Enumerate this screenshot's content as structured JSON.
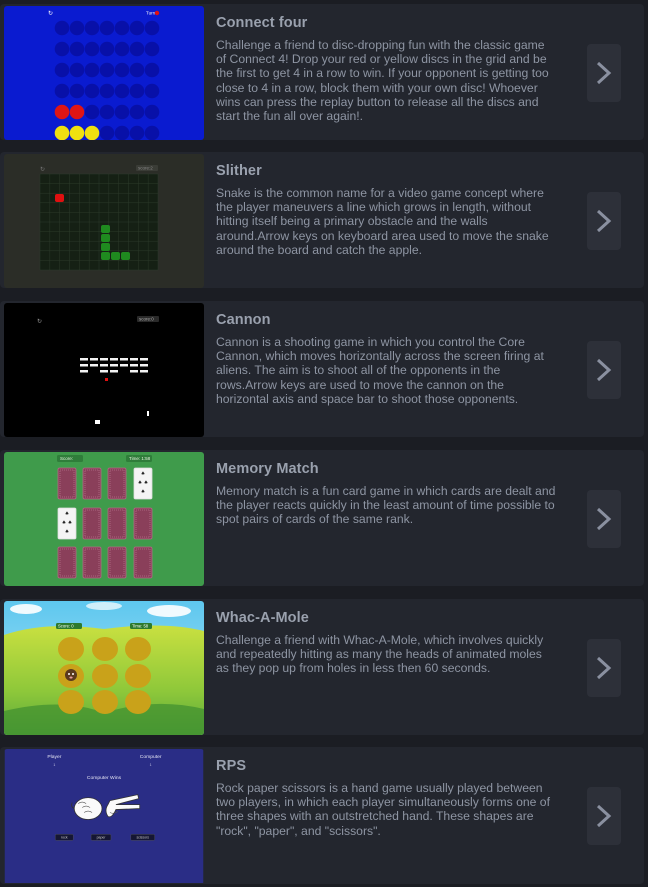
{
  "games": [
    {
      "title": "Connect four",
      "description": "Challenge a friend to disc-dropping fun with the classic game of Connect 4! Drop your red or yellow discs in the grid and be the first to get 4 in a row to win. If your opponent is getting too close to 4 in a row, block them with your own disc! Whoever wins can press the replay button to release all the discs and start the fun all over again!.",
      "thumb": {
        "turn_label": "Turn",
        "replay_icon": "replay-icon"
      }
    },
    {
      "title": "Slither",
      "description": "Snake is the common name for a video game concept where the player maneuvers a line which grows in length, without hitting itself being a primary obstacle and the walls around.Arrow keys on keyboard area used to move the snake around the board and catch the apple.",
      "thumb": {
        "score_label": "score:2",
        "replay_icon": "replay-icon"
      }
    },
    {
      "title": "Cannon",
      "description": "Cannon is a shooting game in which you control the Core Cannon, which moves horizontally across the screen firing at aliens. The aim is to shoot all of the opponents in the rows.Arrow keys are used to move the cannon on the horizontal axis and space bar to shoot those opponents.",
      "thumb": {
        "score_label": "score:0",
        "replay_icon": "replay-icon"
      }
    },
    {
      "title": "Memory Match",
      "description": "Memory match is a fun card game in which cards are dealt and the player reacts quickly in the least amount of time possible to spot pairs of cards of the same rank.",
      "thumb": {
        "score_label": "Score:",
        "timer_label": "Time: 1:58"
      }
    },
    {
      "title": "Whac-A-Mole",
      "description": "Challenge a friend with Whac-A-Mole, which involves quickly and repeatedly hitting as many the heads of animated moles as they pop up from holes in less then 60 seconds.",
      "thumb": {
        "score_label": "Score: 0",
        "timer_label": "Time: 58"
      }
    },
    {
      "title": "RPS",
      "description": "Rock paper scissors is a hand game usually played between two players, in which each player simultaneously forms one of three shapes with an outstretched hand. These shapes are \"rock\", \"paper\", and \"scissors\".",
      "thumb": {
        "player_label": "Player",
        "computer_label": "Computer",
        "player_score": "1",
        "computer_score": "1",
        "result": "Computer Wins",
        "rock_btn": "rock",
        "paper_btn": "paper",
        "scissors_btn": "scissors"
      }
    }
  ],
  "arrow_icon": "chevron-right-icon"
}
